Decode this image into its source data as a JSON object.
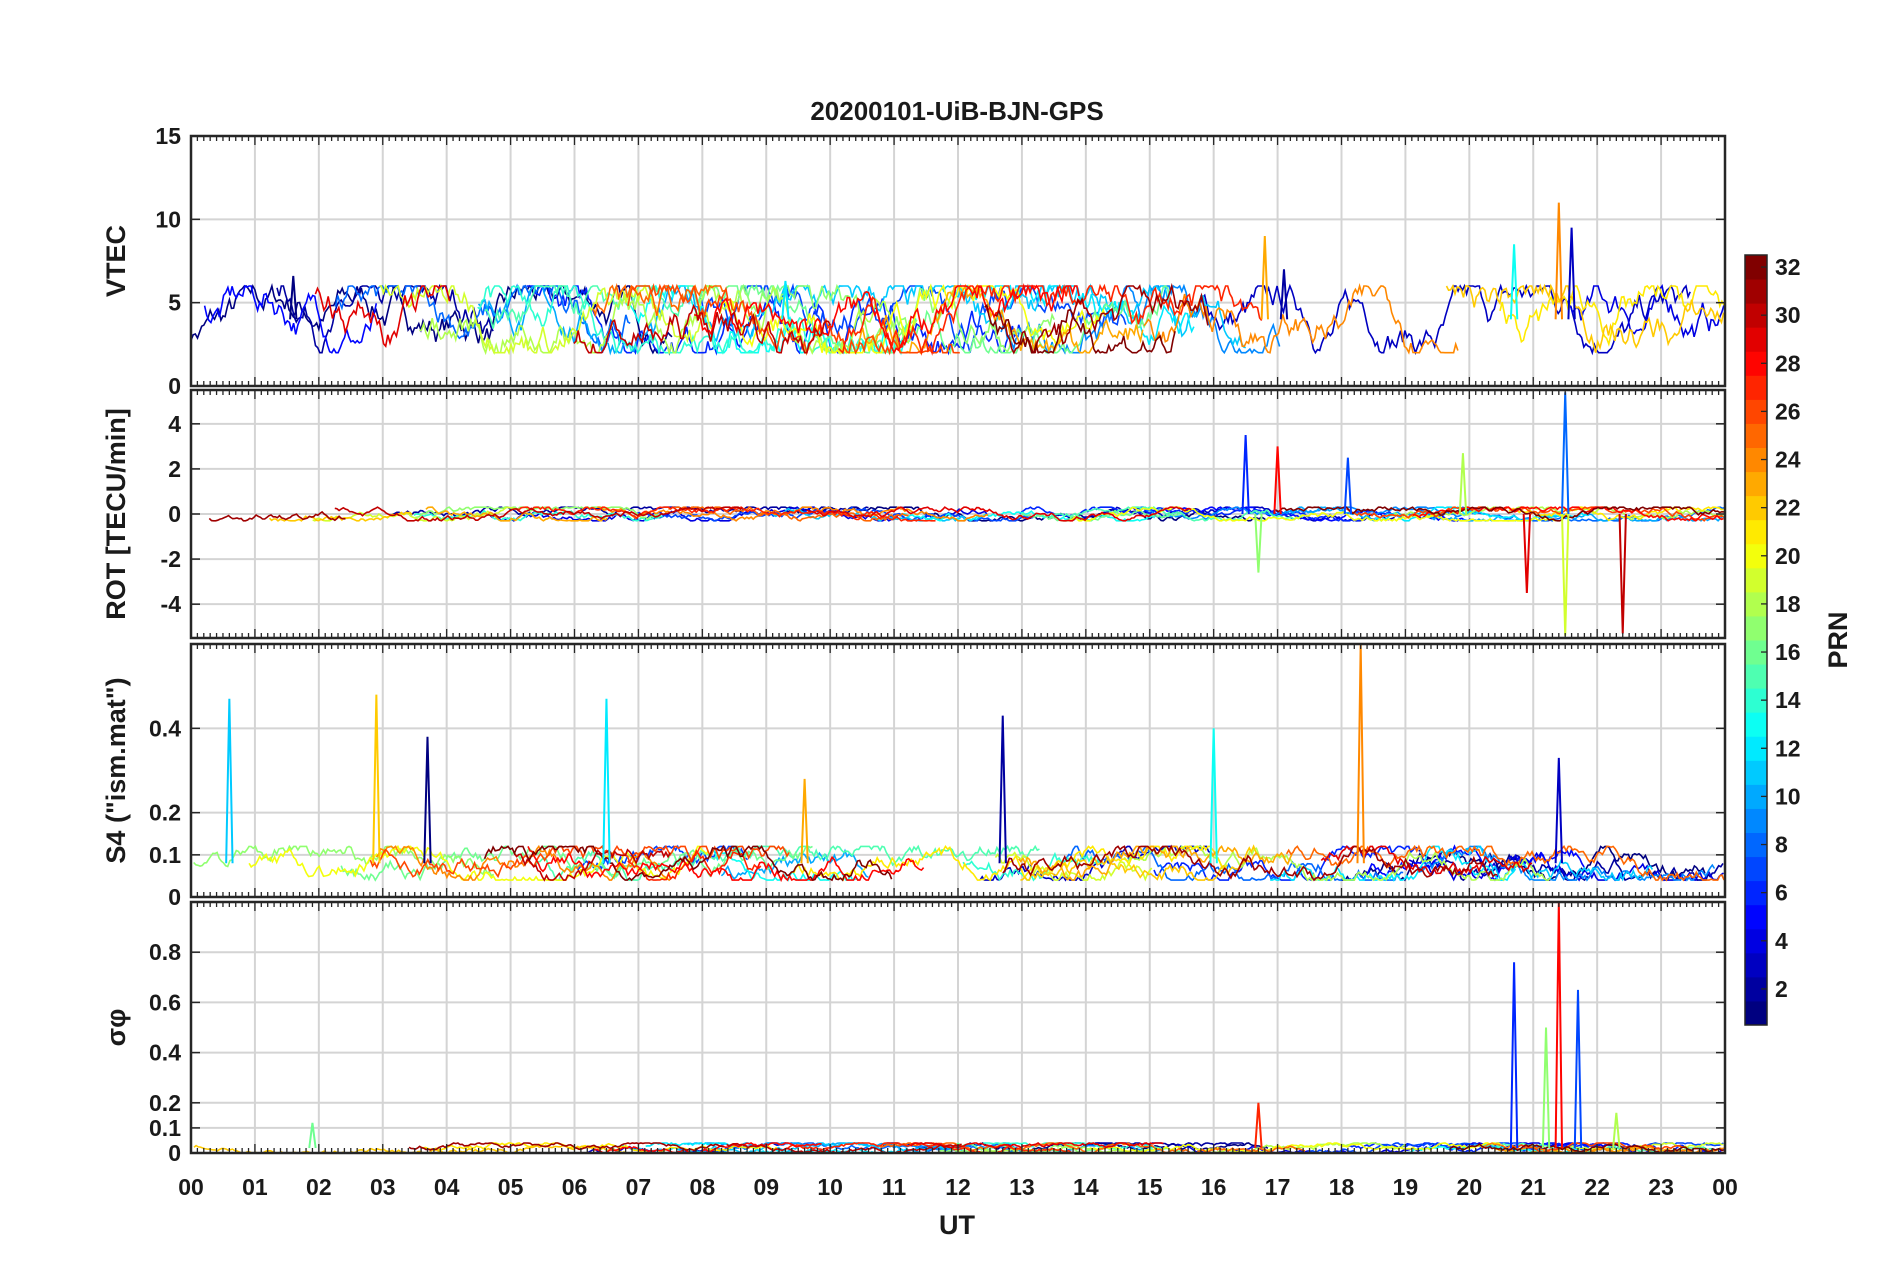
{
  "figure": {
    "title": "20200101-UiB-BJN-GPS",
    "xlabel": "UT",
    "x_tick_labels": [
      "00",
      "01",
      "02",
      "03",
      "04",
      "05",
      "06",
      "07",
      "08",
      "09",
      "10",
      "11",
      "12",
      "13",
      "14",
      "15",
      "16",
      "17",
      "18",
      "19",
      "20",
      "21",
      "22",
      "23",
      "00"
    ]
  },
  "colorbar": {
    "label": "PRN",
    "range": [
      1,
      32
    ],
    "colormap": "jet",
    "ticks": [
      2,
      4,
      6,
      8,
      10,
      12,
      14,
      16,
      18,
      20,
      22,
      24,
      26,
      28,
      30,
      32
    ],
    "tick_labels": [
      "2",
      "4",
      "6",
      "8",
      "10",
      "12",
      "14",
      "16",
      "18",
      "20",
      "22",
      "24",
      "26",
      "28",
      "30",
      "32"
    ],
    "colors": [
      "#00008f",
      "#0000ff",
      "#00ffff",
      "#ffff00",
      "#ff0000",
      "#800000"
    ]
  },
  "chart_data": [
    {
      "type": "line",
      "ylabel": "VTEC",
      "ylim": [
        0,
        15
      ],
      "yticks": [
        0,
        5,
        10,
        15
      ],
      "ytick_labels": [
        "0",
        "5",
        "10",
        "15"
      ],
      "x_unit": "hours UT",
      "grid": true,
      "series_count": 32,
      "color_by": "PRN",
      "background_range": [
        2,
        6
      ],
      "events": [
        {
          "x": 1.6,
          "y": 6.6
        },
        {
          "x": 9.3,
          "y": 6.3
        },
        {
          "x": 16.8,
          "y": 9.0
        },
        {
          "x": 17.1,
          "y": 7.0
        },
        {
          "x": 20.7,
          "y": 8.5
        },
        {
          "x": 21.4,
          "y": 11.0
        },
        {
          "x": 21.6,
          "y": 9.5
        }
      ]
    },
    {
      "type": "line",
      "ylabel": "ROT [TECU/min]",
      "ylim": [
        -5.5,
        5.5
      ],
      "yticks": [
        -4,
        -2,
        0,
        2,
        4
      ],
      "ytick_labels": [
        "-4",
        "-2",
        "0",
        "2",
        "4"
      ],
      "x_unit": "hours UT",
      "grid": true,
      "series_count": 32,
      "color_by": "PRN",
      "background_range": [
        -0.3,
        0.3
      ],
      "events": [
        {
          "x": 16.5,
          "y": 3.5
        },
        {
          "x": 16.7,
          "y": -2.6
        },
        {
          "x": 17.0,
          "y": 3.0
        },
        {
          "x": 18.1,
          "y": 2.5
        },
        {
          "x": 19.9,
          "y": 2.7
        },
        {
          "x": 20.9,
          "y": -3.5
        },
        {
          "x": 21.5,
          "y": 5.4
        },
        {
          "x": 21.5,
          "y": -5.4
        },
        {
          "x": 22.4,
          "y": -5.3
        }
      ]
    },
    {
      "type": "line",
      "ylabel": "S4 (\"ism.mat\")",
      "ylim": [
        0,
        0.6
      ],
      "yticks": [
        0,
        0.1,
        0.2,
        0.4
      ],
      "ytick_labels": [
        "0",
        "0.1",
        "0.2",
        "0.4"
      ],
      "x_unit": "hours UT",
      "grid": true,
      "series_count": 32,
      "color_by": "PRN",
      "background_range": [
        0.04,
        0.12
      ],
      "events": [
        {
          "x": 0.6,
          "y": 0.47
        },
        {
          "x": 2.9,
          "y": 0.48
        },
        {
          "x": 3.7,
          "y": 0.38
        },
        {
          "x": 6.5,
          "y": 0.47
        },
        {
          "x": 9.6,
          "y": 0.28
        },
        {
          "x": 12.7,
          "y": 0.43
        },
        {
          "x": 16.0,
          "y": 0.4
        },
        {
          "x": 18.3,
          "y": 0.6
        },
        {
          "x": 21.4,
          "y": 0.33
        }
      ]
    },
    {
      "type": "line",
      "ylabel": "σφ",
      "ylim": [
        0,
        1.0
      ],
      "yticks": [
        0,
        0.1,
        0.2,
        0.4,
        0.6,
        0.8
      ],
      "ytick_labels": [
        "0",
        "0.1",
        "0.2",
        "0.4",
        "0.6",
        "0.8"
      ],
      "x_unit": "hours UT",
      "grid": true,
      "series_count": 32,
      "color_by": "PRN",
      "background_range": [
        0.0,
        0.04
      ],
      "events": [
        {
          "x": 1.9,
          "y": 0.12
        },
        {
          "x": 16.7,
          "y": 0.2
        },
        {
          "x": 20.7,
          "y": 0.76
        },
        {
          "x": 21.2,
          "y": 0.5
        },
        {
          "x": 21.4,
          "y": 1.0
        },
        {
          "x": 21.7,
          "y": 0.65
        },
        {
          "x": 22.3,
          "y": 0.16
        }
      ]
    }
  ]
}
